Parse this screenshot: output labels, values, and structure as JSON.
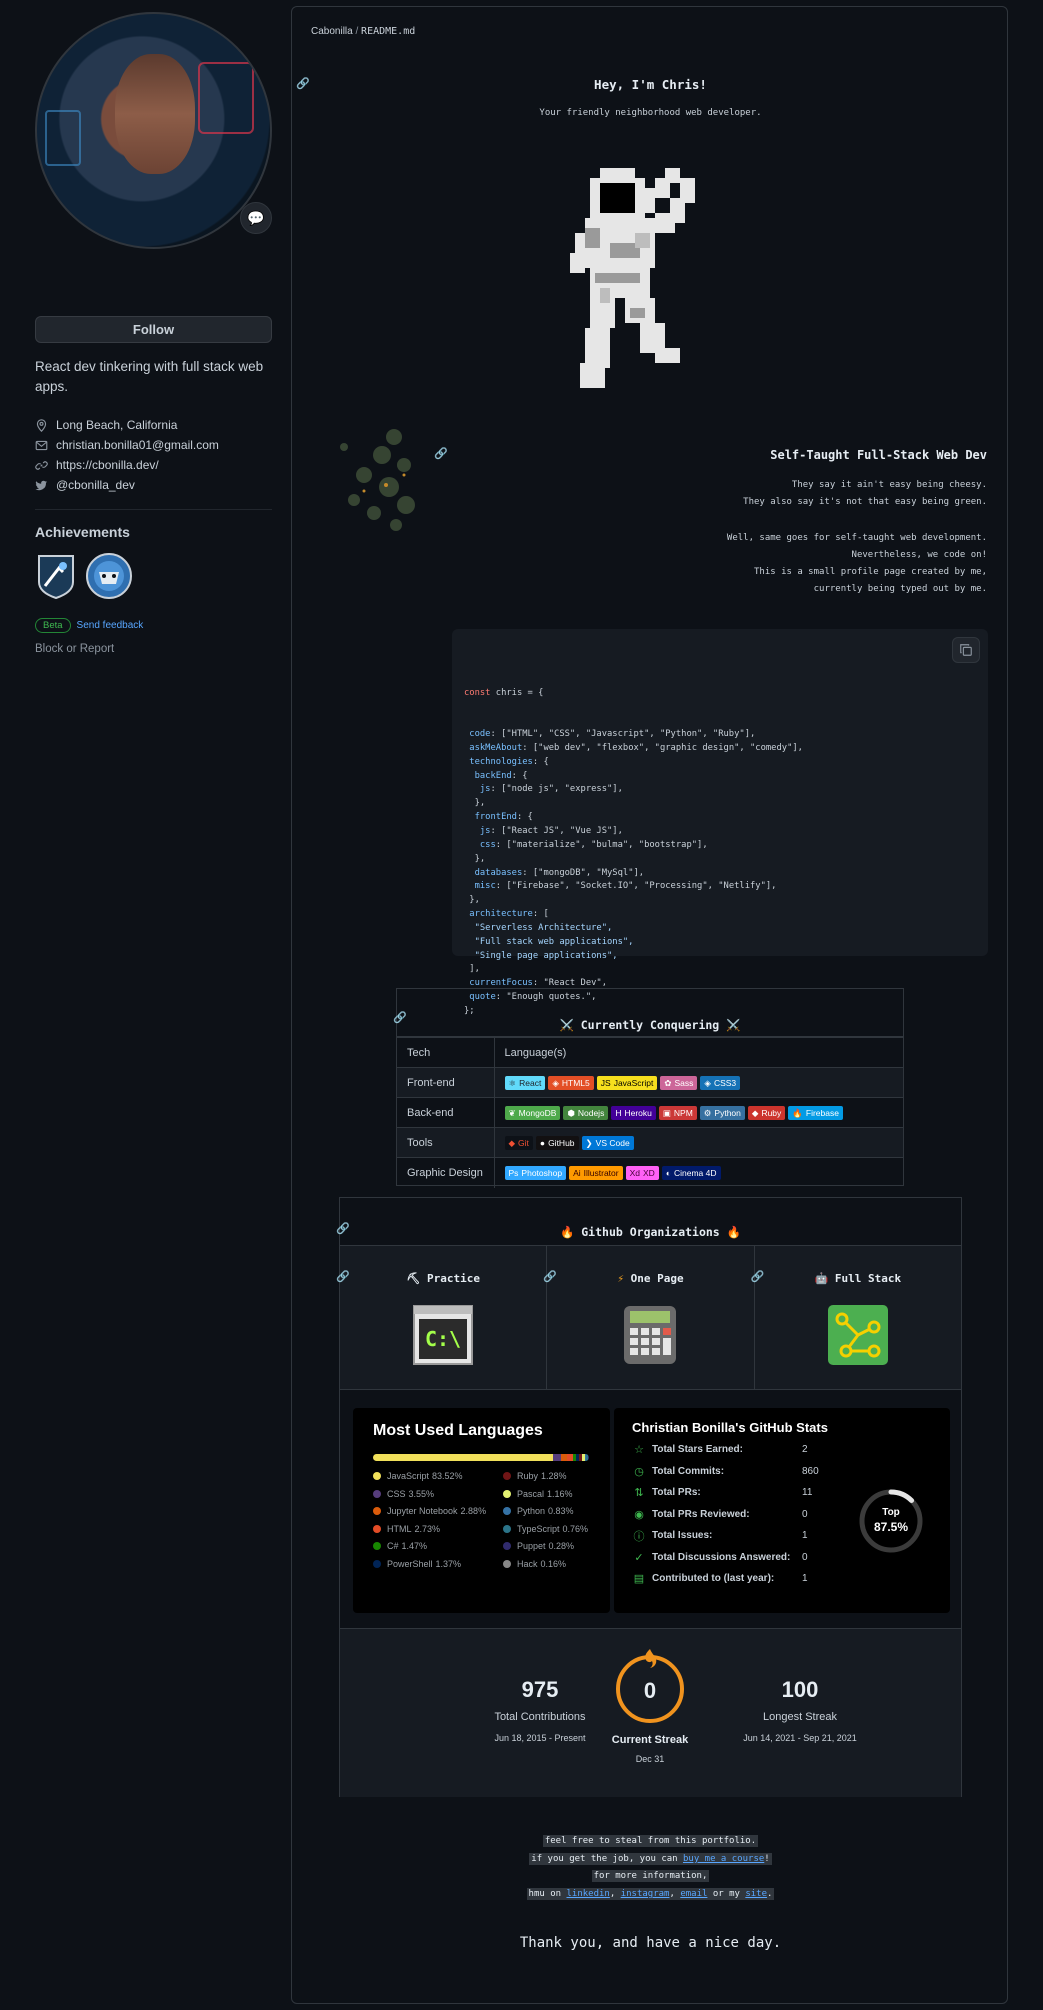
{
  "profile": {
    "follow_label": "Follow",
    "bio": "React dev tinkering with full stack web apps.",
    "location": "Long Beach, California",
    "email": "christian.bonilla01@gmail.com",
    "website": "https://cbonilla.dev/",
    "twitter": "@cbonilla_dev",
    "achievements_title": "Achievements",
    "beta_label": "Beta",
    "feedback_label": "Send feedback",
    "block_label": "Block or Report"
  },
  "readme": {
    "breadcrumb_user": "Cabonilla",
    "breadcrumb_sep": "/",
    "breadcrumb_file": "README.md",
    "greeting": "Hey, I'm Chris!",
    "tagline": "Your friendly neighborhood web developer.",
    "self_taught_title": "Self-Taught Full-Stack Web Dev",
    "para1": [
      "They say it ain't easy being cheesy.",
      "They also say it's not that easy being green."
    ],
    "para2": [
      "Well, same goes for self-taught web development.",
      "Nevertheless, we code on!",
      "This is a small profile page created by me,",
      "currently being typed out by me."
    ],
    "code": {
      "decl_kw": "const",
      "decl_name": "chris",
      "lines": [
        {
          "indent": " ",
          "key": "code",
          "rest": ": [\"HTML\", \"CSS\", \"Javascript\", \"Python\", \"Ruby\"],"
        },
        {
          "indent": " ",
          "key": "askMeAbout",
          "rest": ": [\"web dev\", \"flexbox\", \"graphic design\", \"comedy\"],"
        },
        {
          "indent": " ",
          "key": "technologies",
          "rest": ": {"
        },
        {
          "indent": "  ",
          "key": "backEnd",
          "rest": ": {"
        },
        {
          "indent": "   ",
          "key": "js",
          "rest": ": [\"node js\", \"express\"],"
        },
        {
          "indent": "  ",
          "key": "",
          "rest": "},"
        },
        {
          "indent": "  ",
          "key": "frontEnd",
          "rest": ": {"
        },
        {
          "indent": "   ",
          "key": "js",
          "rest": ": [\"React JS\", \"Vue JS\"],"
        },
        {
          "indent": "   ",
          "key": "css",
          "rest": ": [\"materialize\", \"bulma\", \"bootstrap\"],"
        },
        {
          "indent": "  ",
          "key": "",
          "rest": "},"
        },
        {
          "indent": "  ",
          "key": "databases",
          "rest": ": [\"mongoDB\", \"MySql\"],"
        },
        {
          "indent": "  ",
          "key": "misc",
          "rest": ": [\"Firebase\", \"Socket.IO\", \"Processing\", \"Netlify\"],"
        },
        {
          "indent": " ",
          "key": "",
          "rest": "},"
        },
        {
          "indent": " ",
          "key": "architecture",
          "rest": ": ["
        },
        {
          "indent": "  ",
          "key": "",
          "rest": "\"Serverless Architecture\","
        },
        {
          "indent": "  ",
          "key": "",
          "rest": "\"Full stack web applications\","
        },
        {
          "indent": "  ",
          "key": "",
          "rest": "\"Single page applications\","
        },
        {
          "indent": " ",
          "key": "",
          "rest": "],"
        },
        {
          "indent": " ",
          "key": "currentFocus",
          "rest": ": \"React Dev\","
        },
        {
          "indent": " ",
          "key": "quote",
          "rest": ": \"Enough quotes.\","
        },
        {
          "indent": "",
          "key": "",
          "rest": "};"
        }
      ]
    },
    "conquering": {
      "title": "⚔️ Currently Conquering ⚔️",
      "col_tech": "Tech",
      "col_lang": "Language(s)",
      "rows": [
        {
          "tech": "Front-end",
          "badges": [
            {
              "label": "React",
              "icon": "⚛",
              "color": "#20232a",
              "bg": "#61dafb"
            },
            {
              "label": "HTML5",
              "icon": "◈",
              "bg": "#e34f26"
            },
            {
              "label": "JavaScript",
              "icon": "JS",
              "bg": "#f7df1e",
              "color": "#000"
            },
            {
              "label": "Sass",
              "icon": "✿",
              "bg": "#cc6699"
            },
            {
              "label": "CSS3",
              "icon": "◈",
              "bg": "#1572b6"
            }
          ]
        },
        {
          "tech": "Back-end",
          "badges": [
            {
              "label": "MongoDB",
              "icon": "❦",
              "bg": "#4ea94b"
            },
            {
              "label": "Nodejs",
              "icon": "⬢",
              "bg": "#43853d"
            },
            {
              "label": "Heroku",
              "icon": "H",
              "bg": "#430098"
            },
            {
              "label": "NPM",
              "icon": "▣",
              "bg": "#cb3837"
            },
            {
              "label": "Python",
              "icon": "⚙",
              "bg": "#3670a0"
            },
            {
              "label": "Ruby",
              "icon": "◆",
              "bg": "#cc342d"
            },
            {
              "label": "Firebase",
              "icon": "🔥",
              "bg": "#039be5"
            }
          ]
        },
        {
          "tech": "Tools",
          "badges": [
            {
              "label": "Git",
              "icon": "◆",
              "bg": "#0d1117",
              "color": "#f05033"
            },
            {
              "label": "GitHub",
              "icon": "●",
              "bg": "#121011"
            },
            {
              "label": "VS Code",
              "icon": "❯",
              "bg": "#0078d7"
            }
          ]
        },
        {
          "tech": "Graphic Design",
          "badges": [
            {
              "label": "Photoshop",
              "icon": "Ps",
              "bg": "#31a8ff"
            },
            {
              "label": "Illustrator",
              "icon": "Ai",
              "bg": "#ff9a00",
              "color": "#330000"
            },
            {
              "label": "XD",
              "icon": "Xd",
              "bg": "#ff61f6",
              "color": "#470137"
            },
            {
              "label": "Cinema 4D",
              "icon": "◐",
              "bg": "#011a6a"
            }
          ]
        }
      ]
    },
    "orgs": {
      "title": "🔥 Github Organizations 🔥",
      "items": [
        {
          "icon": "⛏",
          "label": "Practice"
        },
        {
          "icon": "⚡",
          "label": "One Page"
        },
        {
          "icon": "🤖",
          "label": "Full Stack"
        }
      ],
      "terminal_text": "C:\\"
    },
    "languages": {
      "title": "Most Used Languages",
      "items": [
        {
          "name": "JavaScript",
          "pct": "83.52%",
          "value": 83.52,
          "color": "#f1e05a"
        },
        {
          "name": "Ruby",
          "pct": "1.28%",
          "value": 1.28,
          "color": "#701516"
        },
        {
          "name": "CSS",
          "pct": "3.55%",
          "value": 3.55,
          "color": "#563d7c"
        },
        {
          "name": "Pascal",
          "pct": "1.16%",
          "value": 1.16,
          "color": "#e3f171"
        },
        {
          "name": "Jupyter Notebook",
          "pct": "2.88%",
          "value": 2.88,
          "color": "#da5b0b"
        },
        {
          "name": "Python",
          "pct": "0.83%",
          "value": 0.83,
          "color": "#3572a5"
        },
        {
          "name": "HTML",
          "pct": "2.73%",
          "value": 2.73,
          "color": "#e34c26"
        },
        {
          "name": "TypeScript",
          "pct": "0.76%",
          "value": 0.76,
          "color": "#2b7489"
        },
        {
          "name": "C#",
          "pct": "1.47%",
          "value": 1.47,
          "color": "#178600"
        },
        {
          "name": "Puppet",
          "pct": "0.28%",
          "value": 0.28,
          "color": "#302b6d"
        },
        {
          "name": "PowerShell",
          "pct": "1.37%",
          "value": 1.37,
          "color": "#012456"
        },
        {
          "name": "Hack",
          "pct": "0.16%",
          "value": 0.16,
          "color": "#878787"
        }
      ]
    },
    "stats": {
      "title": "Christian Bonilla's GitHub Stats",
      "rows": [
        {
          "icon": "star-icon",
          "glyph": "☆",
          "label": "Total Stars Earned:",
          "value": "2"
        },
        {
          "icon": "history-icon",
          "glyph": "◷",
          "label": "Total Commits:",
          "value": "860"
        },
        {
          "icon": "pull-request-icon",
          "glyph": "⇅",
          "label": "Total PRs:",
          "value": "11"
        },
        {
          "icon": "eye-icon",
          "glyph": "◉",
          "label": "Total PRs Reviewed:",
          "value": "0"
        },
        {
          "icon": "issue-icon",
          "glyph": "ⓘ",
          "label": "Total Issues:",
          "value": "1"
        },
        {
          "icon": "check-icon",
          "glyph": "✓",
          "label": "Total Discussions Answered:",
          "value": "0"
        },
        {
          "icon": "repo-icon",
          "glyph": "▤",
          "label": "Contributed to (last year):",
          "value": "1"
        }
      ],
      "rank_label": "Top",
      "rank_value": "87.5%",
      "rank_fraction": 0.125
    },
    "streak": {
      "total": "975",
      "total_label": "Total Contributions",
      "total_range": "Jun 18, 2015 - Present",
      "current": "0",
      "current_label": "Current Streak",
      "current_date": "Dec 31",
      "longest": "100",
      "longest_label": "Longest Streak",
      "longest_range": "Jun 14, 2021 - Sep 21, 2021"
    },
    "footer": {
      "line1": "feel free to steal from this portfolio.",
      "line2_pre": "if you get the job, you can ",
      "line2_link": "buy me a course",
      "line2_post": "!",
      "line3": "for more information,",
      "line4_pre": "hmu on ",
      "line4_l1": "linkedin",
      "line4_s1": ", ",
      "line4_l2": "instagram",
      "line4_s2": ", ",
      "line4_l3": "email",
      "line4_s3": " or my ",
      "line4_l4": "site",
      "line4_post": ".",
      "thanks": "Thank you, and have a nice day."
    }
  }
}
